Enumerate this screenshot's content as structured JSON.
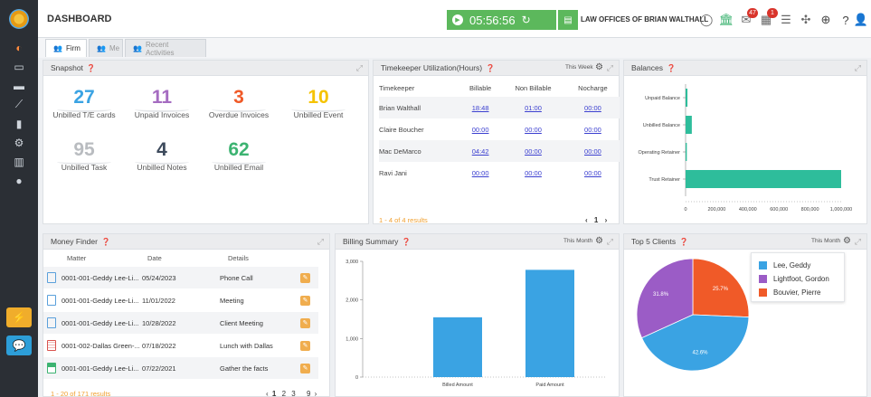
{
  "sidebar": {
    "items": [
      "palette-icon",
      "folder-icon",
      "laptop-icon",
      "chart-line-icon",
      "book-icon",
      "cogs-icon",
      "bar-chart-icon",
      "user-icon"
    ]
  },
  "header": {
    "title": "DASHBOARD",
    "timer": "05:56:56",
    "firm_name": "LAW OFFICES OF BRIAN WALTHALL",
    "mail_badge": "47",
    "calendar_badge": "1"
  },
  "tabs": [
    {
      "label": "Firm",
      "active": true
    },
    {
      "label": "Me",
      "active": false
    },
    {
      "label": "Recent Activities",
      "active": false
    }
  ],
  "snapshot": {
    "title": "Snapshot",
    "stats": [
      {
        "value": "27",
        "label": "Unbilled T/E cards",
        "color": "#3aa3e3"
      },
      {
        "value": "11",
        "label": "Unpaid Invoices",
        "color": "#a56cc1"
      },
      {
        "value": "3",
        "label": "Overdue Invoices",
        "color": "#f05a28"
      },
      {
        "value": "10",
        "label": "Unbilled Event",
        "color": "#f5c300"
      },
      {
        "value": "95",
        "label": "Unbilled Task",
        "color": "#b9bcc0"
      },
      {
        "value": "4",
        "label": "Unbilled Notes",
        "color": "#3d4a5c"
      },
      {
        "value": "62",
        "label": "Unbilled Email",
        "color": "#3cb371"
      }
    ]
  },
  "timekeeper": {
    "title": "Timekeeper Utilization(Hours)",
    "period": "This Week",
    "columns": [
      "Timekeeper",
      "Billable",
      "Non Billable",
      "Nocharge"
    ],
    "rows": [
      [
        "Brian Walthall",
        "18:48",
        "01:00",
        "00:00"
      ],
      [
        "Claire Boucher",
        "00:00",
        "00:00",
        "00:00"
      ],
      [
        "Mac DeMarco",
        "04:42",
        "00:00",
        "00:00"
      ],
      [
        "Ravi Jani",
        "00:00",
        "00:00",
        "00:00"
      ]
    ],
    "results": "1 - 4 of 4 results",
    "page": "1"
  },
  "balances": {
    "title": "Balances",
    "color": "#2ebd9b",
    "chart_data": {
      "type": "bar",
      "orientation": "horizontal",
      "categories": [
        "Unpaid Balance",
        "Unbilled Balance",
        "Operating Retainer",
        "Trust Retainer"
      ],
      "values": [
        12000,
        40000,
        8000,
        1000000
      ],
      "xlim": [
        0,
        1000000
      ],
      "ticks": [
        "0",
        "200,000",
        "400,000",
        "600,000",
        "800,000",
        "1,000,000"
      ]
    }
  },
  "money_finder": {
    "title": "Money Finder",
    "columns": [
      "Matter",
      "Date",
      "Details"
    ],
    "rows": [
      {
        "icon": "document-icon",
        "matter": "0001-001-Geddy Lee-Li...",
        "date": "05/24/2023",
        "details": "Phone Call"
      },
      {
        "icon": "document-icon",
        "matter": "0001-001-Geddy Lee-Li...",
        "date": "11/01/2022",
        "details": "Meeting"
      },
      {
        "icon": "document-icon",
        "matter": "0001-001-Geddy Lee-Li...",
        "date": "10/28/2022",
        "details": "Client Meeting"
      },
      {
        "icon": "calendar-icon",
        "matter": "0001-002-Dallas Green-...",
        "date": "07/18/2022",
        "details": "Lunch with Dallas"
      },
      {
        "icon": "invoice-icon",
        "matter": "0001-001-Geddy Lee-Li...",
        "date": "07/22/2021",
        "details": "Gather the facts"
      }
    ],
    "results": "1 - 20 of 171 results",
    "pages": [
      "1",
      "2",
      "3",
      "9"
    ]
  },
  "billing": {
    "title": "Billing Summary",
    "period": "This Month",
    "color": "#3aa3e3",
    "chart_data": {
      "type": "bar",
      "categories": [
        "Billed Amount",
        "Paid Amount"
      ],
      "values": [
        1550,
        2780
      ],
      "ylim": [
        0,
        3000
      ],
      "yticks": [
        "0",
        "1,000",
        "2,000",
        "3,000"
      ]
    }
  },
  "top_clients": {
    "title": "Top 5 Clients",
    "period": "This Month",
    "chart_data": {
      "type": "pie",
      "series": [
        {
          "name": "Lee, Geddy",
          "value": 42.6,
          "label": "42.6%",
          "color": "#3aa3e3"
        },
        {
          "name": "Lightfoot, Gordon",
          "value": 31.8,
          "label": "31.8%",
          "color": "#9b5cc6"
        },
        {
          "name": "Bouvier, Pierre",
          "value": 25.7,
          "label": "25.7%",
          "color": "#f05a28"
        }
      ]
    }
  }
}
